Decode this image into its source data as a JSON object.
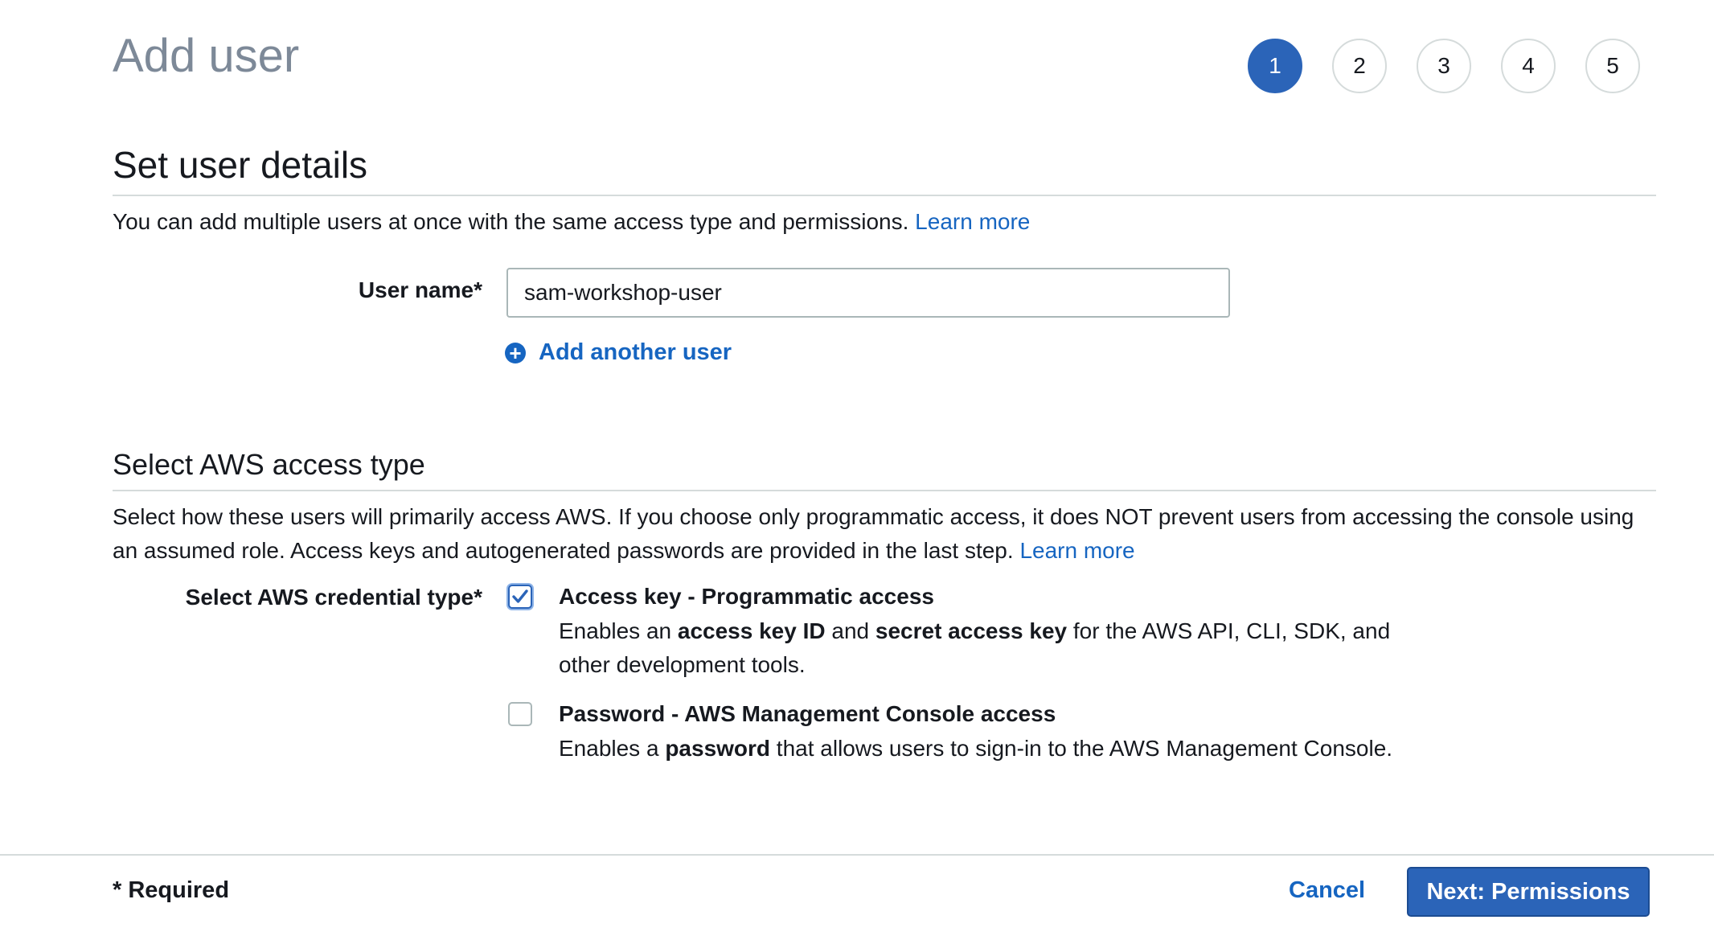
{
  "page": {
    "title": "Add user"
  },
  "steps": [
    {
      "label": "1",
      "active": true
    },
    {
      "label": "2",
      "active": false
    },
    {
      "label": "3",
      "active": false
    },
    {
      "label": "4",
      "active": false
    },
    {
      "label": "5",
      "active": false
    }
  ],
  "details": {
    "heading": "Set user details",
    "description": "You can add multiple users at once with the same access type and permissions.",
    "learn_more": "Learn more",
    "username_label": "User name*",
    "username_value": "sam-workshop-user",
    "add_another": "Add another user",
    "add_icon": "plus-circle-icon"
  },
  "access": {
    "heading": "Select AWS access type",
    "description_line1": "Select how these users will primarily access AWS. If you choose only programmatic access, it does NOT prevent users from accessing the console using",
    "description_line2": "an assumed role. Access keys and autogenerated passwords are provided in the last step.",
    "learn_more": "Learn more",
    "credential_label": "Select AWS credential type*",
    "options": [
      {
        "title": "Access key - Programmatic access",
        "checked": true,
        "desc_p1": "Enables an ",
        "desc_b1": "access key ID",
        "desc_p2": " and ",
        "desc_b2": "secret access key",
        "desc_p3": " for the AWS API, CLI, SDK, and",
        "desc_line2": "other development tools."
      },
      {
        "title": "Password - AWS Management Console access",
        "checked": false,
        "desc_p1": "Enables a ",
        "desc_b1": "password",
        "desc_p2": " that allows users to sign-in to the AWS Management Console."
      }
    ]
  },
  "footer": {
    "required": "* Required",
    "cancel": "Cancel",
    "next": "Next: Permissions"
  },
  "colors": {
    "primary": "#2b64b8",
    "link": "#1665c1",
    "title_gray": "#7d8998",
    "border": "#d5dbdb"
  }
}
